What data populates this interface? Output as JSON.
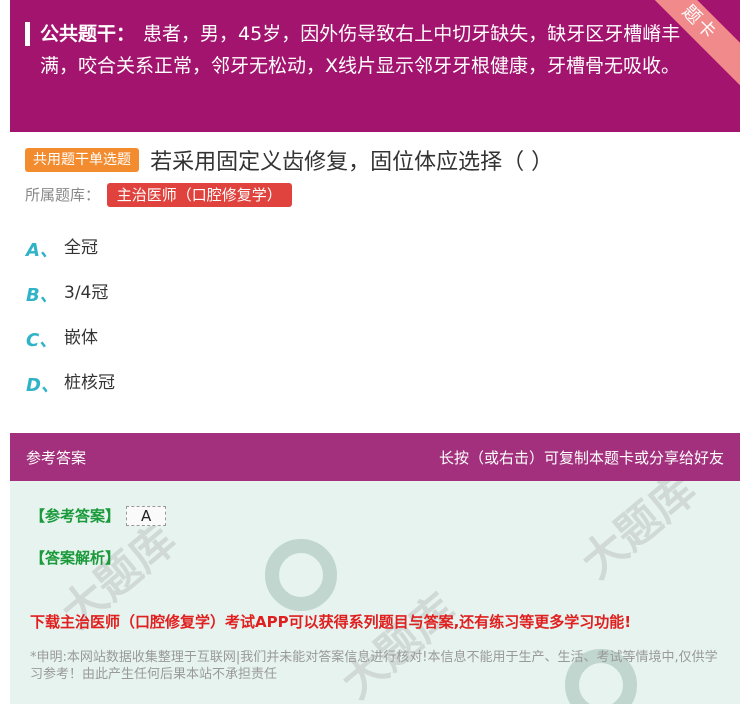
{
  "stem": {
    "label": "公共题干：",
    "text": "患者，男，45岁，因外伤导致右上中切牙缺失，缺牙区牙槽嵴丰满，咬合关系正常，邻牙无松动，X线片显示邻牙牙根健康，牙槽骨无吸收。",
    "ribbon": "题卡"
  },
  "question": {
    "type_tag": "共用题干单选题",
    "title": "若采用固定义齿修复，固位体应选择（ ）",
    "bank_label": "所属题库：",
    "bank_name": "主治医师（口腔修复学）"
  },
  "options": [
    {
      "letter": "A、",
      "text": "全冠"
    },
    {
      "letter": "B、",
      "text": "3/4冠"
    },
    {
      "letter": "C、",
      "text": "嵌体"
    },
    {
      "letter": "D、",
      "text": "桩核冠"
    }
  ],
  "answer": {
    "header_left": "参考答案",
    "header_right": "长按（或右击）可复制本题卡或分享给好友",
    "ref_label": "【参考答案】",
    "ref_value": "A",
    "analysis_label": "【答案解析】",
    "promo": "下载主治医师（口腔修复学）考试APP可以获得系列题目与答案,还有练习等更多学习功能!",
    "disclaimer": "*申明:本网站数据收集整理于互联网|我们并未能对答案信息进行核对!本信息不能用于生产、生活、考试等情境中,仅供学习参考！由此产生任何后果本站不承担责任"
  },
  "colors": {
    "stem_bg": "#a3146e",
    "answer_header_bg": "#a3307c",
    "type_tag_bg": "#f28c2e",
    "bank_tag_bg": "#e0433d",
    "option_letter": "#2fb3c7",
    "promo_text": "#e01f1f",
    "answer_label": "#1a9a3a"
  }
}
